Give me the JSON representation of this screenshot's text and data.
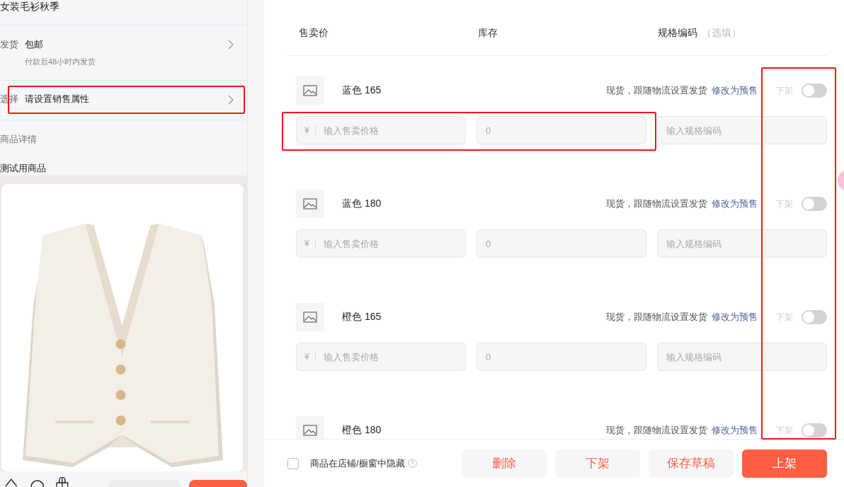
{
  "preview": {
    "title": "女装毛衫秋季",
    "rows": [
      {
        "label": "发货",
        "value": "包邮",
        "note": "付款后48小时内发货"
      },
      {
        "label": "选择",
        "value": "请设置销售属性"
      }
    ],
    "detail_heading": "商品详情",
    "detail_title": "测试用商品"
  },
  "columns": [
    {
      "label": "售卖价"
    },
    {
      "label": "库存"
    },
    {
      "label": "规格编码",
      "hint": "（选填）"
    }
  ],
  "variants": [
    {
      "name": "蓝色 165",
      "shipping": "现货，跟随物流设置发货",
      "link": "修改为预售",
      "status_label": "下架",
      "on": false,
      "price": {
        "currency": "¥",
        "placeholder": "输入售卖价格"
      },
      "stock": {
        "placeholder": "0"
      },
      "code": {
        "placeholder": "输入规格编码"
      }
    },
    {
      "name": "蓝色 180",
      "shipping": "现货，跟随物流设置发货",
      "link": "修改为预售",
      "status_label": "下架",
      "on": false,
      "price": {
        "currency": "¥",
        "placeholder": "输入售卖价格"
      },
      "stock": {
        "placeholder": "0"
      },
      "code": {
        "placeholder": "输入规格编码"
      }
    },
    {
      "name": "橙色 165",
      "shipping": "现货，跟随物流设置发货",
      "link": "修改为预售",
      "status_label": "下架",
      "on": false,
      "price": {
        "currency": "¥",
        "placeholder": "输入售卖价格"
      },
      "stock": {
        "placeholder": "0"
      },
      "code": {
        "placeholder": "输入规格编码"
      }
    },
    {
      "name": "橙色 180",
      "shipping": "现货，跟随物流设置发货",
      "link": "修改为预售",
      "status_label": "下架",
      "on": false
    }
  ],
  "footer": {
    "hide_option": {
      "label": "商品在店铺/橱窗中隐藏",
      "checked": false
    },
    "buttons": [
      {
        "label": "删除",
        "kind": "secondary"
      },
      {
        "label": "下架",
        "kind": "secondary"
      },
      {
        "label": "保存草稿",
        "kind": "secondary"
      },
      {
        "label": "上架",
        "kind": "primary"
      }
    ]
  }
}
